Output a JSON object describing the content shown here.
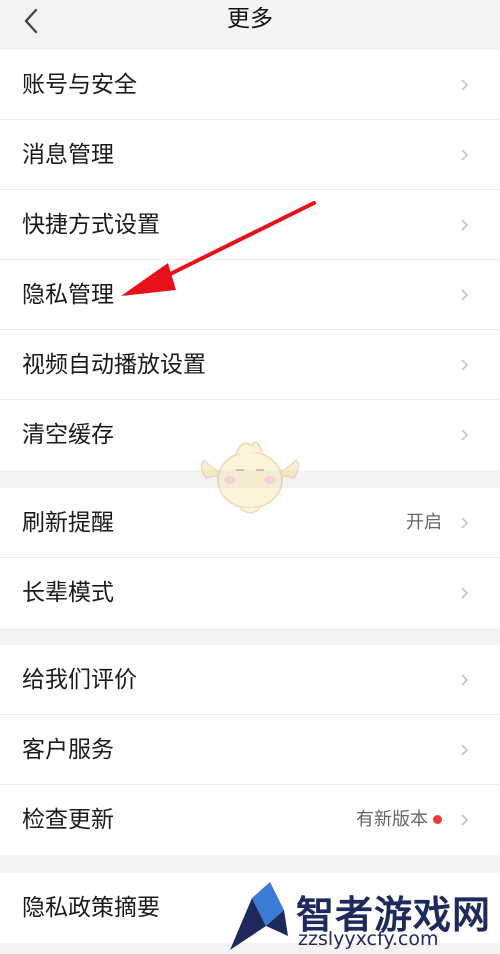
{
  "header": {
    "title": "更多"
  },
  "groups": [
    {
      "items": [
        {
          "label": "账号与安全"
        },
        {
          "label": "消息管理"
        },
        {
          "label": "快捷方式设置"
        },
        {
          "label": "隐私管理"
        },
        {
          "label": "视频自动播放设置"
        },
        {
          "label": "清空缓存"
        }
      ]
    },
    {
      "items": [
        {
          "label": "刷新提醒",
          "value": "开启"
        },
        {
          "label": "长辈模式"
        }
      ]
    },
    {
      "items": [
        {
          "label": "给我们评价"
        },
        {
          "label": "客户服务"
        },
        {
          "label": "检查更新",
          "value": "有新版本"
        }
      ]
    },
    {
      "items": [
        {
          "label": "隐私政策摘要"
        }
      ]
    }
  ],
  "icons": {
    "back": "chevron-left-icon",
    "row": "chevron-right-icon"
  },
  "colors": {
    "annotation_arrow": "#e8101a",
    "update_dot": "#f03a3a"
  },
  "watermark": {
    "name": "智者游戏网",
    "url": "zzslyyxcfy.com"
  }
}
